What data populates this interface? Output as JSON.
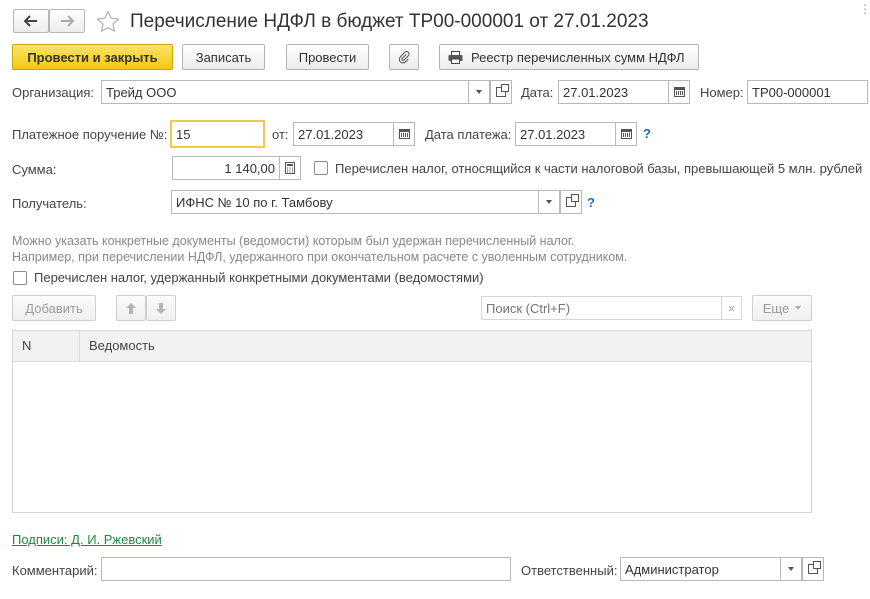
{
  "title": "Перечисление НДФЛ в бюджет ТР00-000001 от 27.01.2023",
  "toolbar": {
    "post_close": "Провести и закрыть",
    "save": "Записать",
    "post": "Провести",
    "registry": "Реестр перечисленных сумм НДФЛ"
  },
  "org": {
    "label": "Организация:",
    "value": "Трейд ООО"
  },
  "date": {
    "label": "Дата:",
    "value": "27.01.2023"
  },
  "number": {
    "label": "Номер:",
    "value": "ТР00-000001"
  },
  "payment": {
    "label": "Платежное поручение №:",
    "value": "15",
    "from_label": "от:",
    "from_value": "27.01.2023",
    "pay_date_label": "Дата платежа:",
    "pay_date_value": "27.01.2023",
    "help": "?"
  },
  "sum": {
    "label": "Сумма:",
    "value": "1 140,00",
    "check_label": "Перечислен налог, относящийся к части налоговой базы, превышающей 5 млн. рублей"
  },
  "recipient": {
    "label": "Получатель:",
    "value": "ИФНС № 10 по г. Тамбову",
    "help": "?"
  },
  "hint": {
    "line1": "Можно указать конкретные документы (ведомости) которым был удержан перечисленный налог.",
    "line2": "Например, при перечислении НДФЛ, удержанного при окончательном расчете с уволенным сотрудником."
  },
  "docs_check_label": "Перечислен налог, удержанный конкретными документами (ведомостями)",
  "table_toolbar": {
    "add": "Добавить",
    "search_placeholder": "Поиск (Ctrl+F)",
    "clear": "×",
    "more": "Еще"
  },
  "table": {
    "columns": [
      "N",
      "Ведомость"
    ]
  },
  "signatures_link": "Подписи: Д. И. Ржевский",
  "comment": {
    "label": "Комментарий:",
    "value": ""
  },
  "responsible": {
    "label": "Ответственный:",
    "value": "Администратор"
  },
  "colors": {
    "accent": "#f3c90f",
    "link": "#1a8a3a",
    "help": "#1a6cc4",
    "hint": "#888888"
  }
}
